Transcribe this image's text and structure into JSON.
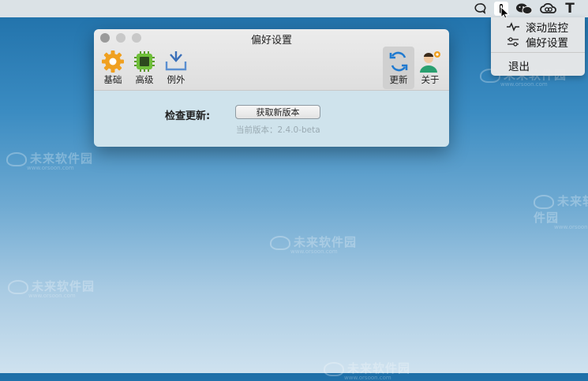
{
  "watermark": {
    "brand": "未来软件园",
    "site": "www.orsoon.com"
  },
  "menubar": {
    "text_icon": "T"
  },
  "dropdown": {
    "items": [
      {
        "label": "滚动监控",
        "icon": "pulse-icon"
      },
      {
        "label": "偏好设置",
        "icon": "sliders-icon"
      },
      {
        "label": "退出"
      }
    ]
  },
  "window": {
    "title": "偏好设置",
    "toolbar": [
      {
        "label": "基础",
        "icon": "gear-icon"
      },
      {
        "label": "高级",
        "icon": "chip-icon"
      },
      {
        "label": "例外",
        "icon": "inbox-arrow-icon"
      },
      {
        "label": "更新",
        "icon": "refresh-icon"
      },
      {
        "label": "关于",
        "icon": "person-icon"
      }
    ],
    "update": {
      "label": "检查更新:",
      "button": "获取新版本",
      "version": "当前版本：2.4.0-beta"
    }
  },
  "colors": {
    "accent": "#1f7ad0",
    "gear": "#f0a020",
    "chip": "#6fbf3a"
  }
}
